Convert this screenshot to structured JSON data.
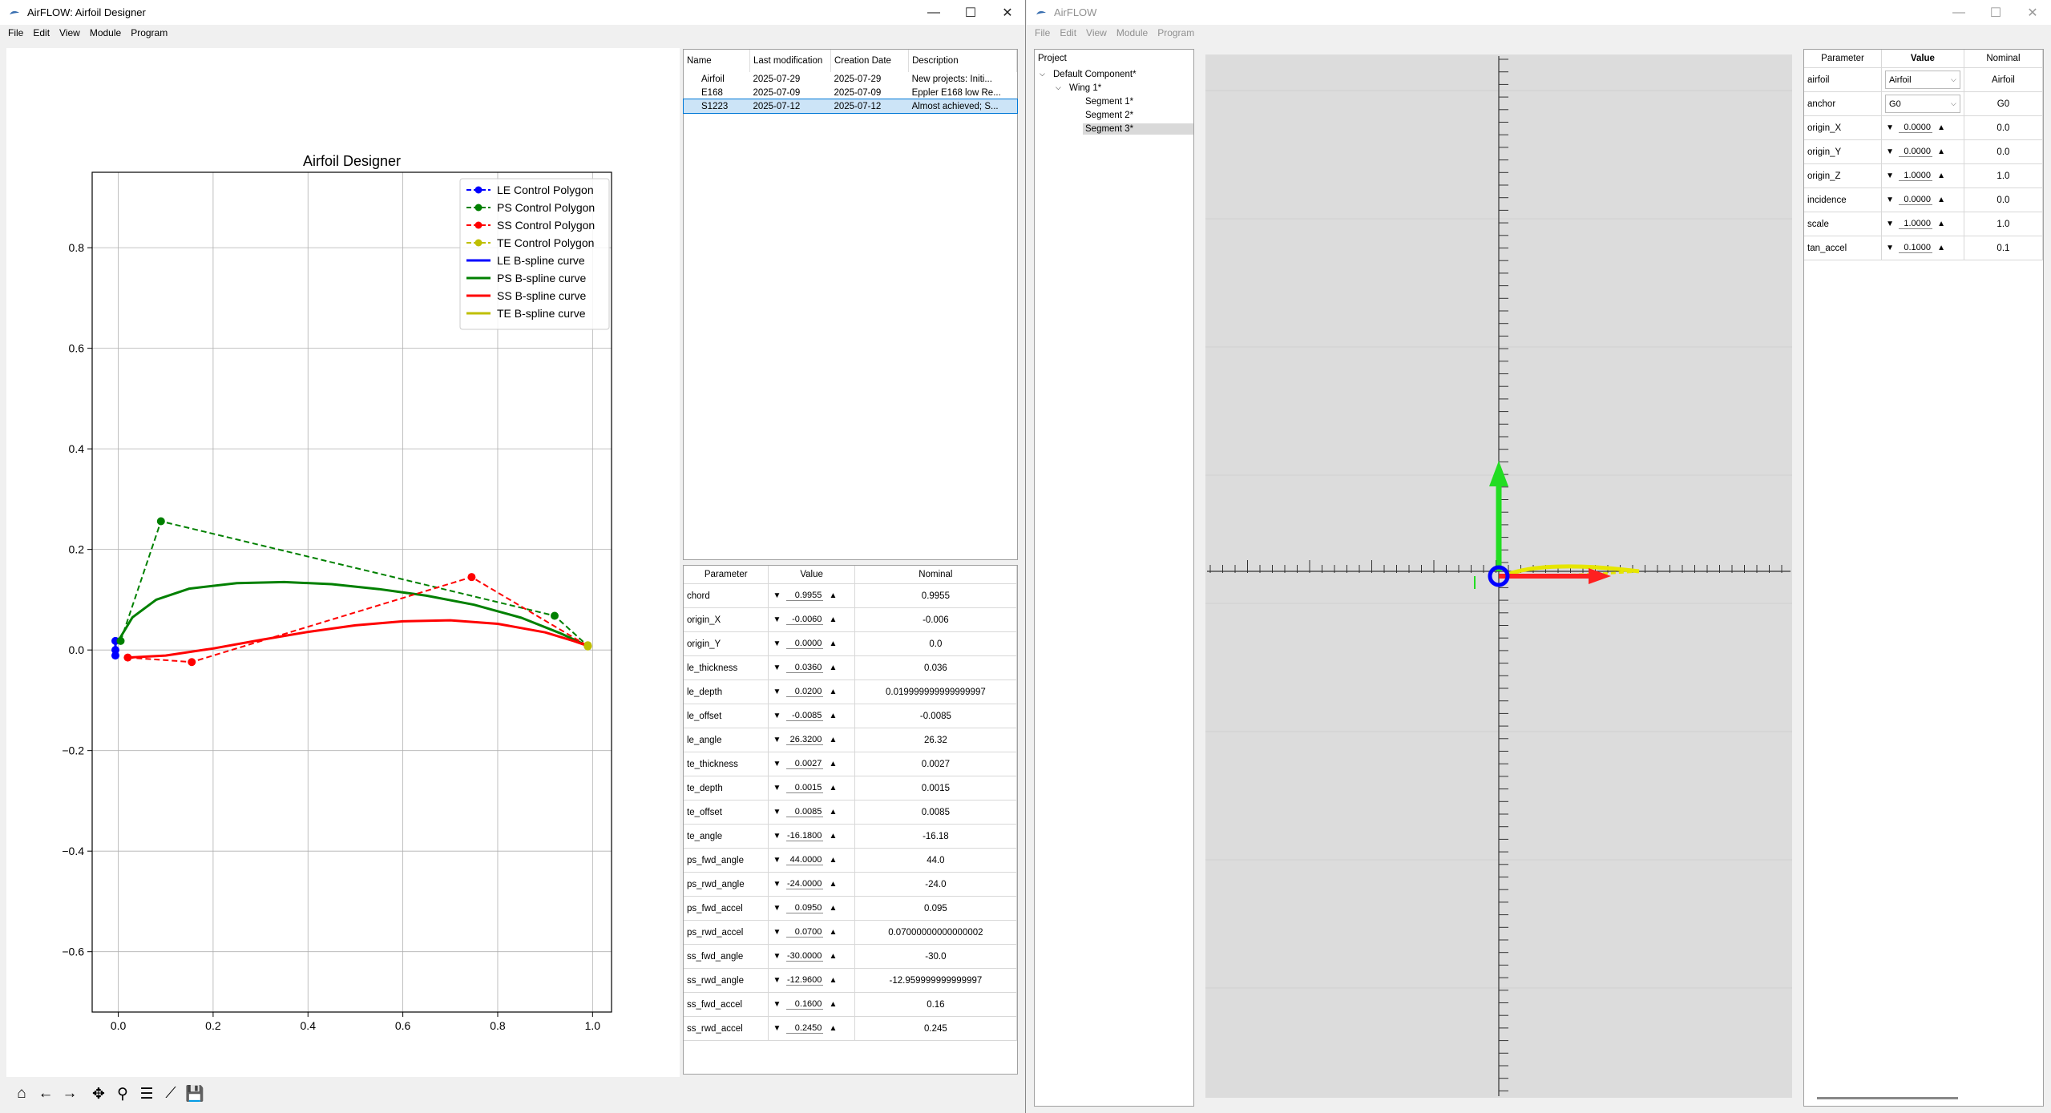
{
  "left_window": {
    "title": "AirFLOW: Airfoil Designer",
    "menu": [
      "File",
      "Edit",
      "View",
      "Module",
      "Program"
    ],
    "plot": {
      "title": "Airfoil Designer",
      "xticks": [
        "0.0",
        "0.2",
        "0.4",
        "0.6",
        "0.8",
        "1.0"
      ],
      "yticks": [
        "0.8",
        "0.6",
        "0.4",
        "0.2",
        "0.0",
        "−0.2",
        "−0.4",
        "−0.6"
      ],
      "legend": [
        "LE Control Polygon",
        "PS Control Polygon",
        "SS Control Polygon",
        "TE Control Polygon",
        "LE B-spline curve",
        "PS B-spline curve",
        "SS B-spline curve",
        "TE B-spline curve"
      ],
      "colors": {
        "le": "#0000ff",
        "ps": "#008000",
        "ss": "#ff0000",
        "te": "#bfbf00"
      }
    },
    "chart_data": {
      "type": "line",
      "title": "Airfoil Designer",
      "xlim": [
        -0.055,
        1.04
      ],
      "ylim": [
        -0.72,
        0.95
      ],
      "grid": true,
      "legend_position": "top-right",
      "series": [
        {
          "name": "LE Control Polygon",
          "style": "dashed-markers",
          "color": "#0000ff",
          "points": [
            [
              -0.006,
              -0.011
            ],
            [
              -0.006,
              0.0
            ],
            [
              -0.006,
              0.018
            ]
          ]
        },
        {
          "name": "PS Control Polygon",
          "style": "dashed-markers",
          "color": "#008000",
          "points": [
            [
              0.005,
              0.018
            ],
            [
              0.09,
              0.256
            ],
            [
              0.92,
              0.068
            ],
            [
              0.99,
              0.008
            ]
          ]
        },
        {
          "name": "SS Control Polygon",
          "style": "dashed-markers",
          "color": "#ff0000",
          "points": [
            [
              0.02,
              -0.015
            ],
            [
              0.155,
              -0.024
            ],
            [
              0.745,
              0.145
            ],
            [
              0.99,
              0.008
            ]
          ]
        },
        {
          "name": "TE Control Polygon",
          "style": "dashed-markers",
          "color": "#bfbf00",
          "points": [
            [
              0.99,
              0.0095
            ],
            [
              0.99,
              0.007
            ]
          ]
        },
        {
          "name": "LE B-spline curve",
          "style": "solid",
          "color": "#0000ff",
          "points": [
            [
              -0.006,
              -0.011
            ],
            [
              -0.006,
              0.018
            ]
          ]
        },
        {
          "name": "PS B-spline curve",
          "style": "solid",
          "color": "#008000",
          "points": [
            [
              0.0,
              0.018
            ],
            [
              0.03,
              0.065
            ],
            [
              0.08,
              0.1
            ],
            [
              0.15,
              0.122
            ],
            [
              0.25,
              0.133
            ],
            [
              0.35,
              0.135
            ],
            [
              0.45,
              0.131
            ],
            [
              0.55,
              0.121
            ],
            [
              0.65,
              0.108
            ],
            [
              0.75,
              0.09
            ],
            [
              0.85,
              0.064
            ],
            [
              0.93,
              0.034
            ],
            [
              0.99,
              0.008
            ]
          ]
        },
        {
          "name": "SS B-spline curve",
          "style": "solid",
          "color": "#ff0000",
          "points": [
            [
              0.02,
              -0.015
            ],
            [
              0.1,
              -0.011
            ],
            [
              0.2,
              0.003
            ],
            [
              0.3,
              0.02
            ],
            [
              0.4,
              0.036
            ],
            [
              0.5,
              0.049
            ],
            [
              0.6,
              0.057
            ],
            [
              0.7,
              0.059
            ],
            [
              0.8,
              0.052
            ],
            [
              0.9,
              0.035
            ],
            [
              0.96,
              0.018
            ],
            [
              0.99,
              0.008
            ]
          ]
        },
        {
          "name": "TE B-spline curve",
          "style": "solid",
          "color": "#bfbf00",
          "points": [
            [
              0.99,
              0.0095
            ],
            [
              0.99,
              0.007
            ]
          ]
        }
      ]
    },
    "projects": {
      "headers": [
        "Name",
        "Last modification",
        "Creation Date",
        "Description"
      ],
      "rows": [
        [
          "Airfoil",
          "2025-07-29",
          "2025-07-29",
          "New projects: Initi..."
        ],
        [
          "E168",
          "2025-07-09",
          "2025-07-09",
          "Eppler E168 low Re..."
        ],
        [
          "S1223",
          "2025-07-12",
          "2025-07-12",
          "Almost achieved; S..."
        ]
      ],
      "selected_index": 2
    },
    "params": {
      "headers": [
        "Parameter",
        "Value",
        "Nominal"
      ],
      "rows": [
        [
          "chord",
          "0.9955",
          "0.9955"
        ],
        [
          "origin_X",
          "-0.0060",
          "-0.006"
        ],
        [
          "origin_Y",
          "0.0000",
          "0.0"
        ],
        [
          "le_thickness",
          "0.0360",
          "0.036"
        ],
        [
          "le_depth",
          "0.0200",
          "0.019999999999999997"
        ],
        [
          "le_offset",
          "-0.0085",
          "-0.0085"
        ],
        [
          "le_angle",
          "26.3200",
          "26.32"
        ],
        [
          "te_thickness",
          "0.0027",
          "0.0027"
        ],
        [
          "te_depth",
          "0.0015",
          "0.0015"
        ],
        [
          "te_offset",
          "0.0085",
          "0.0085"
        ],
        [
          "te_angle",
          "-16.1800",
          "-16.18"
        ],
        [
          "ps_fwd_angle",
          "44.0000",
          "44.0"
        ],
        [
          "ps_rwd_angle",
          "-24.0000",
          "-24.0"
        ],
        [
          "ps_fwd_accel",
          "0.0950",
          "0.095"
        ],
        [
          "ps_rwd_accel",
          "0.0700",
          "0.07000000000000002"
        ],
        [
          "ss_fwd_angle",
          "-30.0000",
          "-30.0"
        ],
        [
          "ss_rwd_angle",
          "-12.9600",
          "-12.959999999999997"
        ],
        [
          "ss_fwd_accel",
          "0.1600",
          "0.16"
        ],
        [
          "ss_rwd_accel",
          "0.2450",
          "0.245"
        ]
      ]
    },
    "toolbar": [
      {
        "name": "home-icon",
        "glyph": "⌂"
      },
      {
        "name": "back-icon",
        "glyph": "←"
      },
      {
        "name": "forward-icon",
        "glyph": "→"
      },
      {
        "name": "pan-icon",
        "glyph": "✥"
      },
      {
        "name": "zoom-icon",
        "glyph": "⚲"
      },
      {
        "name": "configure-subplots-icon",
        "glyph": "☰"
      },
      {
        "name": "edit-axis-icon",
        "glyph": "⟋"
      },
      {
        "name": "save-figure-icon",
        "glyph": "💾"
      }
    ]
  },
  "right_window": {
    "title": "AirFLOW",
    "menu": [
      "File",
      "Edit",
      "View",
      "Module",
      "Program"
    ],
    "tree": {
      "header": "Project",
      "items": [
        {
          "label": "Default Component*",
          "level": 0,
          "expanded": true
        },
        {
          "label": "Wing 1*",
          "level": 1,
          "expanded": true
        },
        {
          "label": "Segment 1*",
          "level": 2
        },
        {
          "label": "Segment 2*",
          "level": 2
        },
        {
          "label": "Segment 3*",
          "level": 2,
          "selected": true
        }
      ]
    },
    "props": {
      "headers": [
        "Parameter",
        "Value",
        "Nominal"
      ],
      "rows": [
        {
          "name": "airfoil",
          "kind": "combo",
          "value": "Airfoil",
          "nominal": "Airfoil"
        },
        {
          "name": "anchor",
          "kind": "combo",
          "value": "G0",
          "nominal": "G0"
        },
        {
          "name": "origin_X",
          "kind": "spin",
          "value": "0.0000",
          "nominal": "0.0"
        },
        {
          "name": "origin_Y",
          "kind": "spin",
          "value": "0.0000",
          "nominal": "0.0"
        },
        {
          "name": "origin_Z",
          "kind": "spin",
          "value": "1.0000",
          "nominal": "1.0"
        },
        {
          "name": "incidence",
          "kind": "spin",
          "value": "0.0000",
          "nominal": "0.0"
        },
        {
          "name": "scale",
          "kind": "spin",
          "value": "1.0000",
          "nominal": "1.0"
        },
        {
          "name": "tan_accel",
          "kind": "spin",
          "value": "0.1000",
          "nominal": "0.1"
        }
      ]
    }
  }
}
